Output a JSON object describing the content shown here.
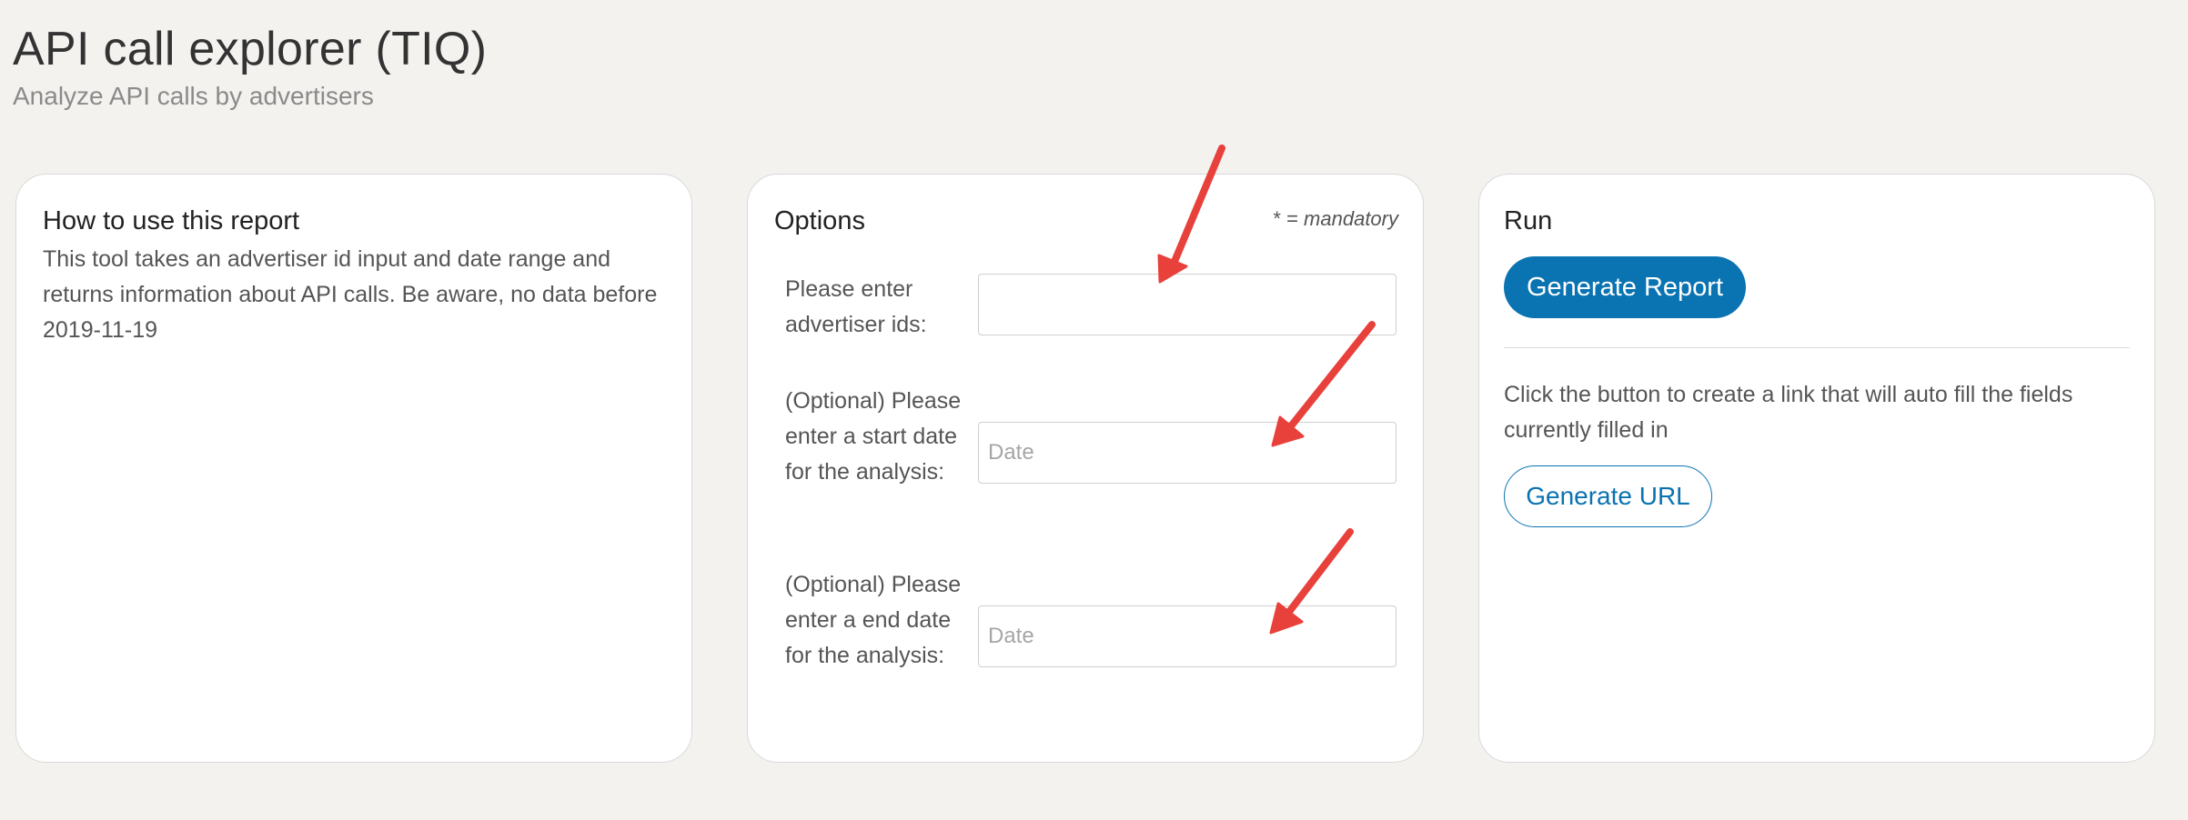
{
  "header": {
    "title": "API call explorer (TIQ)",
    "subtitle": "Analyze API calls by advertisers"
  },
  "howto": {
    "title": "How to use this report",
    "description": "This tool takes an advertiser id input and date range and returns information about API calls. Be aware, no data before 2019-11-19"
  },
  "options": {
    "title": "Options",
    "mandatory_note": {
      "symbol": "* =",
      "word": "mandatory"
    },
    "fields": [
      {
        "label": "Please enter advertiser ids:",
        "value": "",
        "placeholder": ""
      },
      {
        "label": "(Optional) Please enter a start date for the analysis:",
        "value": "",
        "placeholder": "Date"
      },
      {
        "label": "(Optional) Please enter a end date for the analysis:",
        "value": "",
        "placeholder": "Date"
      }
    ]
  },
  "run": {
    "title": "Run",
    "generate_report_label": "Generate Report",
    "description": "Click the button to create a link that will auto fill the fields currently filled in",
    "generate_url_label": "Generate URL"
  },
  "colors": {
    "page_background": "#f3f2ef",
    "card_background": "#ffffff",
    "accent": "#0a73b1",
    "annotation_arrow": "#e8413c"
  },
  "icons": [
    "annotation-arrow"
  ]
}
